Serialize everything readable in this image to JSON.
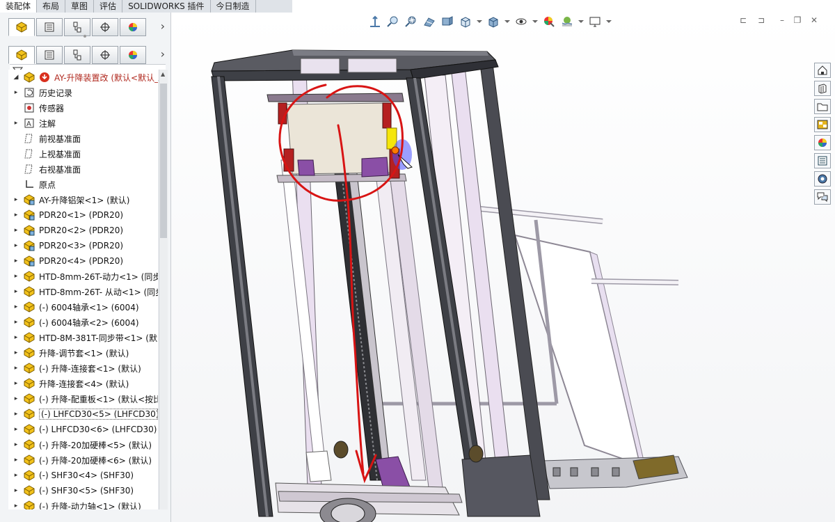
{
  "command_tabs": [
    "装配体",
    "布局",
    "草图",
    "评估",
    "SOLIDWORKS 插件",
    "今日制造"
  ],
  "active_tab_index": 0,
  "panel_tabs": [
    "feature-manager-icon",
    "property-manager-icon",
    "configuration-manager-icon",
    "dimxpert-icon",
    "display-manager-icon"
  ],
  "tree": {
    "root": "AY-升降装置改  (默认<默认_显",
    "items": [
      {
        "label": "历史记录",
        "icon": "history-icon",
        "expand": true
      },
      {
        "label": "传感器",
        "icon": "sensor-icon",
        "expand": false
      },
      {
        "label": "注解",
        "icon": "annotation-icon",
        "expand": true
      },
      {
        "label": "前视基准面",
        "icon": "plane-icon",
        "expand": false
      },
      {
        "label": "上视基准面",
        "icon": "plane-icon",
        "expand": false
      },
      {
        "label": "右视基准面",
        "icon": "plane-icon",
        "expand": false
      },
      {
        "label": "原点",
        "icon": "origin-icon",
        "expand": false
      },
      {
        "label": "AY-升降铝架<1> (默认)",
        "icon": "subassembly-icon",
        "expand": true
      },
      {
        "label": "PDR20<1> (PDR20)",
        "icon": "subassembly-icon",
        "expand": true
      },
      {
        "label": "PDR20<2> (PDR20)",
        "icon": "subassembly-icon",
        "expand": true
      },
      {
        "label": "PDR20<3> (PDR20)",
        "icon": "subassembly-icon",
        "expand": true
      },
      {
        "label": "PDR20<4> (PDR20)",
        "icon": "subassembly-icon",
        "expand": true
      },
      {
        "label": "HTD-8mm-26T-动力<1> (同步",
        "icon": "part-icon",
        "expand": true
      },
      {
        "label": "HTD-8mm-26T- 从动<1> (同步",
        "icon": "part-icon",
        "expand": true
      },
      {
        "label": "(-) 6004轴承<1> (6004)",
        "icon": "part-icon",
        "expand": true
      },
      {
        "label": "(-) 6004轴承<2> (6004)",
        "icon": "part-icon",
        "expand": true
      },
      {
        "label": "HTD-8M-381T-同步带<1> (默",
        "icon": "part-icon",
        "expand": true
      },
      {
        "label": "升降-调节套<1> (默认)",
        "icon": "part-icon",
        "expand": true
      },
      {
        "label": "(-) 升降-连接套<1> (默认)",
        "icon": "part-icon",
        "expand": true
      },
      {
        "label": "升降-连接套<4> (默认)",
        "icon": "part-icon",
        "expand": true
      },
      {
        "label": "(-) 升降-配重板<1> (默认<按比",
        "icon": "part-icon",
        "expand": true
      },
      {
        "label": "(-) LHFCD30<5> (LHFCD30)",
        "icon": "part-icon",
        "expand": true,
        "selected": true
      },
      {
        "label": "(-) LHFCD30<6> (LHFCD30)",
        "icon": "part-icon",
        "expand": true
      },
      {
        "label": "(-) 升降-20加硬棒<5> (默认)",
        "icon": "part-icon",
        "expand": true
      },
      {
        "label": "(-) 升降-20加硬棒<6> (默认)",
        "icon": "part-icon",
        "expand": true
      },
      {
        "label": "(-) SHF30<4> (SHF30)",
        "icon": "part-icon",
        "expand": true
      },
      {
        "label": "(-) SHF30<5> (SHF30)",
        "icon": "part-icon",
        "expand": true
      },
      {
        "label": "(-) 升降-动力轴<1> (默认)",
        "icon": "part-icon",
        "expand": true
      }
    ]
  },
  "heads_up_toolbar": [
    "zoom-to-fit-icon",
    "zoom-to-area-icon",
    "previous-view-icon",
    "section-view-icon",
    "dynamic-annotation-icon",
    "view-orientation-icon",
    "display-style-icon",
    "hide-show-icon",
    "edit-appearance-icon",
    "apply-scene-icon",
    "view-settings-icon"
  ],
  "task_pane": [
    "home-icon",
    "design-library-icon",
    "file-explorer-icon",
    "view-palette-icon",
    "appearances-icon",
    "custom-properties-icon",
    "solidworks-resources-icon",
    "forum-icon"
  ],
  "colors": {
    "annotation_red": "#d81414",
    "frame": "#3e4046",
    "rails": "#eadff0",
    "highlight": "#f5e60a"
  }
}
